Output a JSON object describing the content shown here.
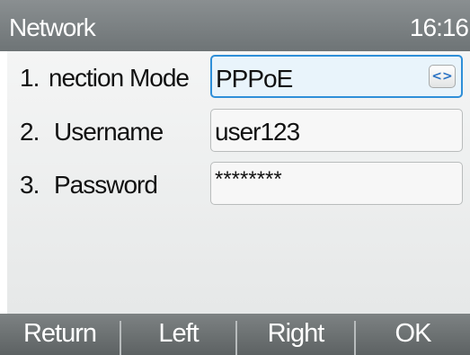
{
  "header": {
    "title": "Network",
    "time": "16:16"
  },
  "settings": [
    {
      "number": "1.",
      "label": "Connection Mode",
      "value": "PPPoE",
      "control": "select",
      "selected": true
    },
    {
      "number": "2.",
      "label": "Username",
      "value": "user123",
      "control": "text"
    },
    {
      "number": "3.",
      "label": "Password",
      "value": "********",
      "control": "password"
    }
  ],
  "select_arrow": "<>",
  "softkeys": [
    "Return",
    "Left",
    "Right",
    "OK"
  ],
  "colors": {
    "title_bar": "#7d8283",
    "selection_border": "#2f8fd8",
    "arrow": "#2b73c4"
  }
}
